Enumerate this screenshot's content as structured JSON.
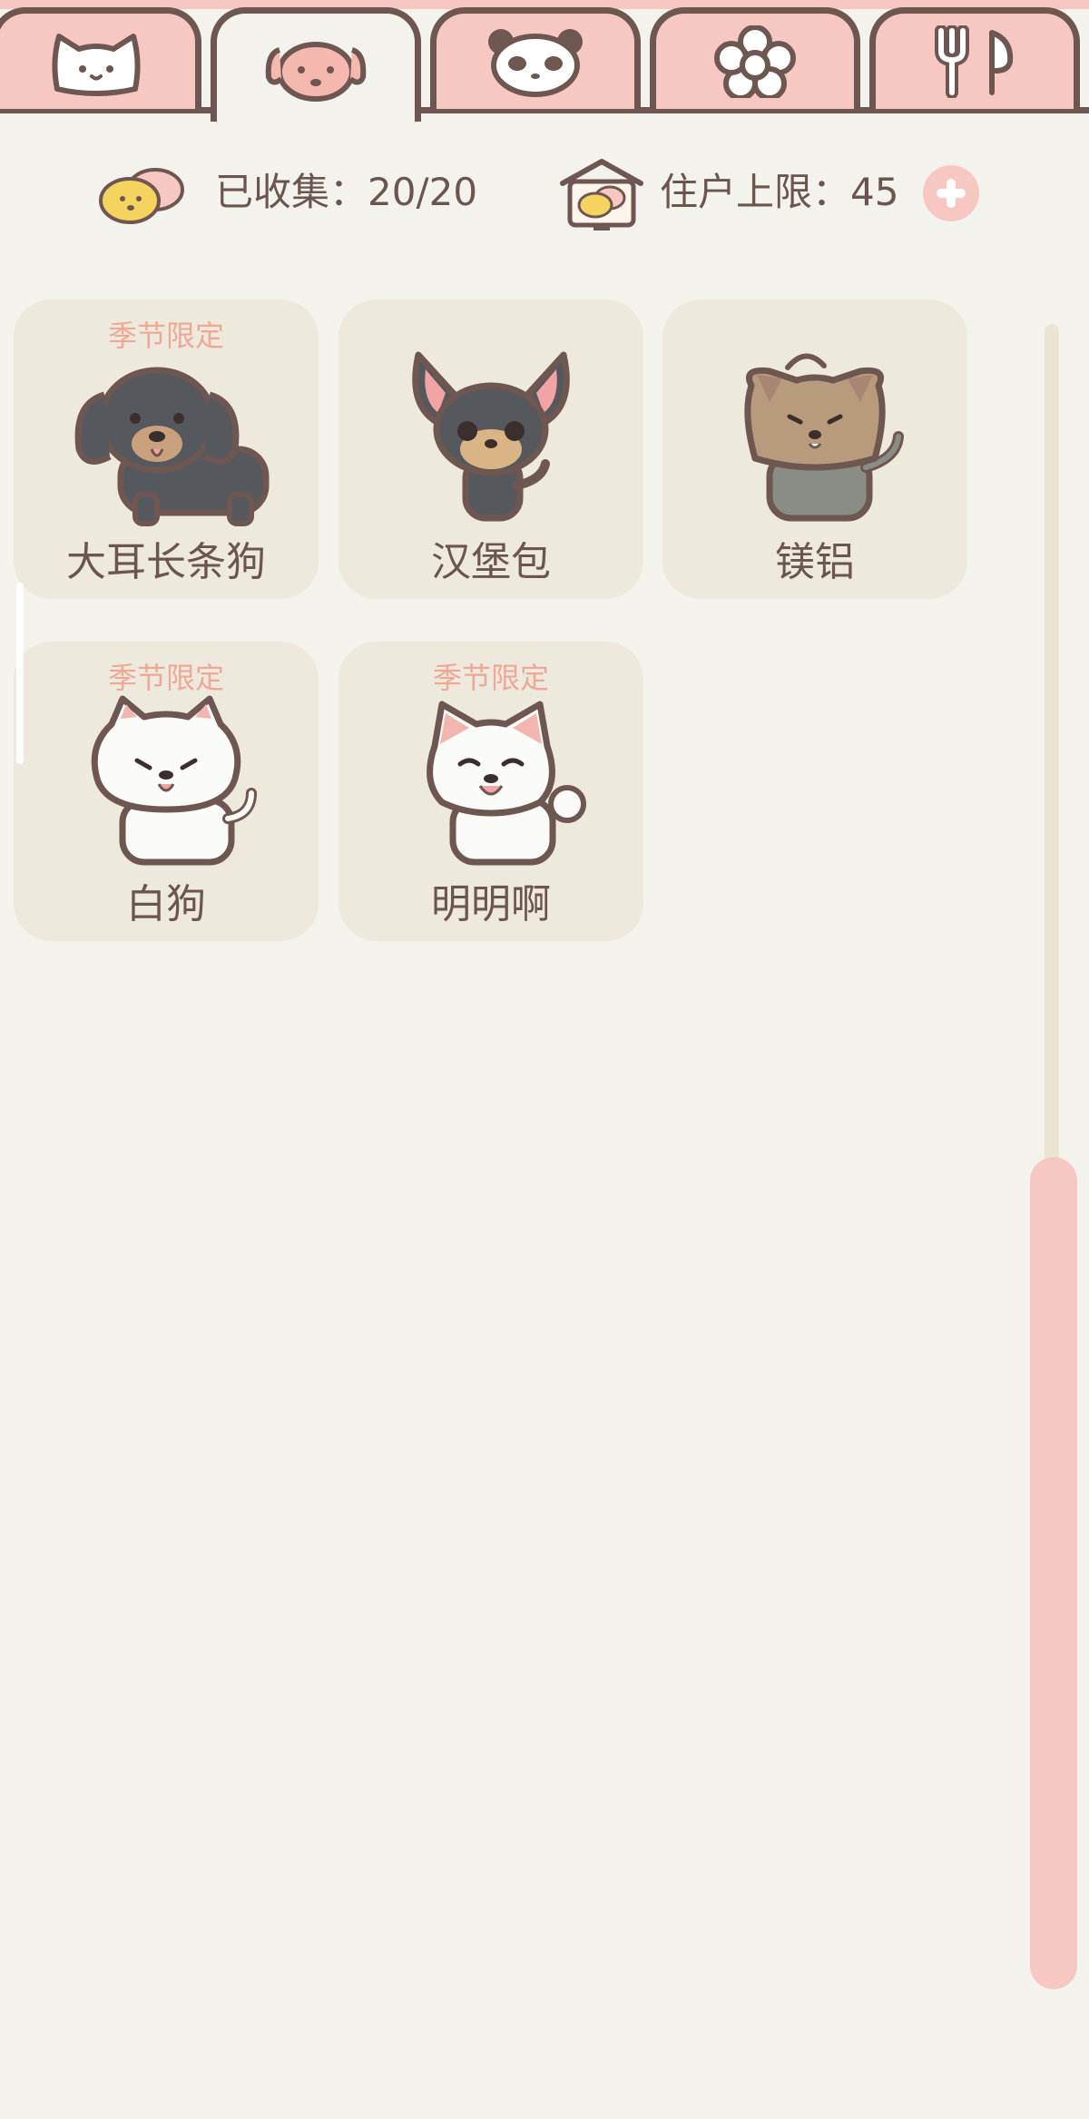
{
  "tabs": [
    {
      "icon": "cat-face-icon"
    },
    {
      "icon": "dog-face-icon",
      "active": true
    },
    {
      "icon": "panda-face-icon"
    },
    {
      "icon": "flower-icon"
    },
    {
      "icon": "fork-knife-icon"
    }
  ],
  "stats": {
    "collected_label": "已收集：20/20",
    "residents_label": "住户上限：45"
  },
  "pets": [
    {
      "name": "大耳长条狗",
      "tag": "季节限定"
    },
    {
      "name": "汉堡包",
      "tag": ""
    },
    {
      "name": "镁铝",
      "tag": ""
    },
    {
      "name": "白狗",
      "tag": "季节限定"
    },
    {
      "name": "明明啊",
      "tag": "季节限定"
    }
  ],
  "colors": {
    "accent_pink": "#f7c8c2",
    "outline_brown": "#6e5651",
    "background": "#f4f2ed",
    "card_bg": "#ede9dd",
    "tag_text": "#efa896",
    "text": "#6a554f"
  }
}
